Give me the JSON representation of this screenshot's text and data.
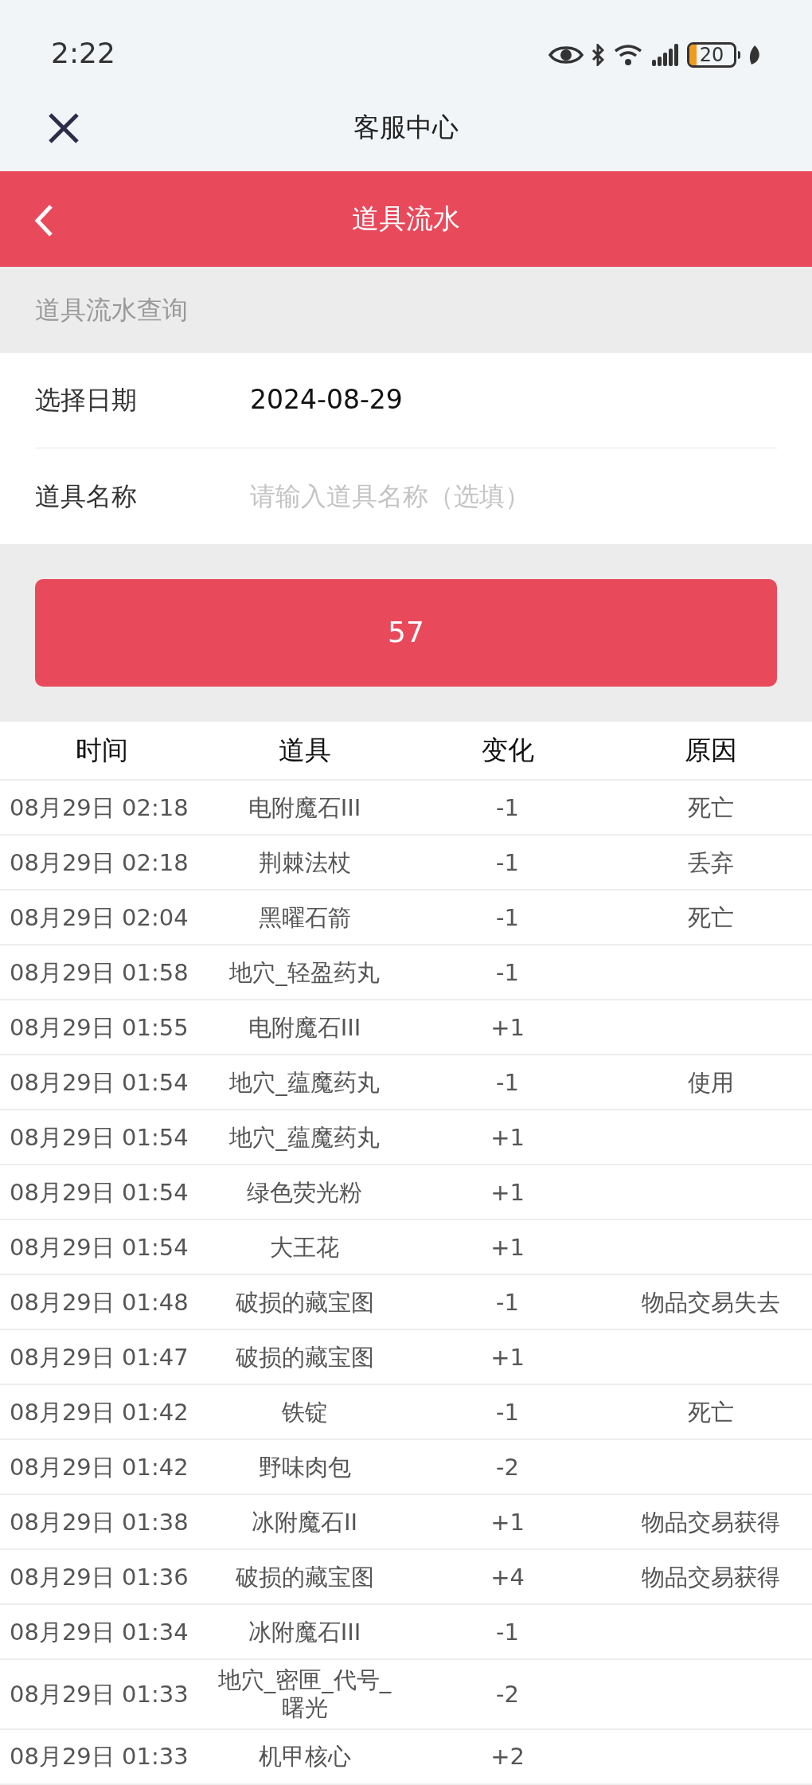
{
  "status_bar": {
    "time": "2:22",
    "battery": "20"
  },
  "top_bar": {
    "title": "客服中心"
  },
  "header": {
    "title": "道具流水"
  },
  "section": {
    "title": "道具流水查询"
  },
  "form": [
    {
      "label": "选择日期",
      "value": "2024-08-29"
    },
    {
      "label": "道具名称",
      "placeholder": "请输入道具名称（选填）"
    }
  ],
  "submit_button": {
    "label": "57"
  },
  "table": {
    "columns": [
      "时间",
      "道具",
      "变化",
      "原因"
    ],
    "rows": [
      [
        "08月29日 02:18",
        "电附魔石III",
        "-1",
        "死亡"
      ],
      [
        "08月29日 02:18",
        "荆棘法杖",
        "-1",
        "丢弃"
      ],
      [
        "08月29日 02:04",
        "黑曜石箭",
        "-1",
        "死亡"
      ],
      [
        "08月29日 01:58",
        "地穴_轻盈药丸",
        "-1",
        ""
      ],
      [
        "08月29日 01:55",
        "电附魔石III",
        "+1",
        ""
      ],
      [
        "08月29日 01:54",
        "地穴_蕴魔药丸",
        "-1",
        "使用"
      ],
      [
        "08月29日 01:54",
        "地穴_蕴魔药丸",
        "+1",
        ""
      ],
      [
        "08月29日 01:54",
        "绿色荧光粉",
        "+1",
        ""
      ],
      [
        "08月29日 01:54",
        "大王花",
        "+1",
        ""
      ],
      [
        "08月29日 01:48",
        "破损的藏宝图",
        "-1",
        "物品交易失去"
      ],
      [
        "08月29日 01:47",
        "破损的藏宝图",
        "+1",
        ""
      ],
      [
        "08月29日 01:42",
        "铁锭",
        "-1",
        "死亡"
      ],
      [
        "08月29日 01:42",
        "野味肉包",
        "-2",
        ""
      ],
      [
        "08月29日 01:38",
        "冰附魔石II",
        "+1",
        "物品交易获得"
      ],
      [
        "08月29日 01:36",
        "破损的藏宝图",
        "+4",
        "物品交易获得"
      ],
      [
        "08月29日 01:34",
        "冰附魔石III",
        "-1",
        ""
      ],
      [
        "08月29日 01:33",
        "地穴_密匣_代号_曙光",
        "-2",
        ""
      ],
      [
        "08月29日 01:33",
        "机甲核心",
        "+2",
        ""
      ]
    ]
  }
}
